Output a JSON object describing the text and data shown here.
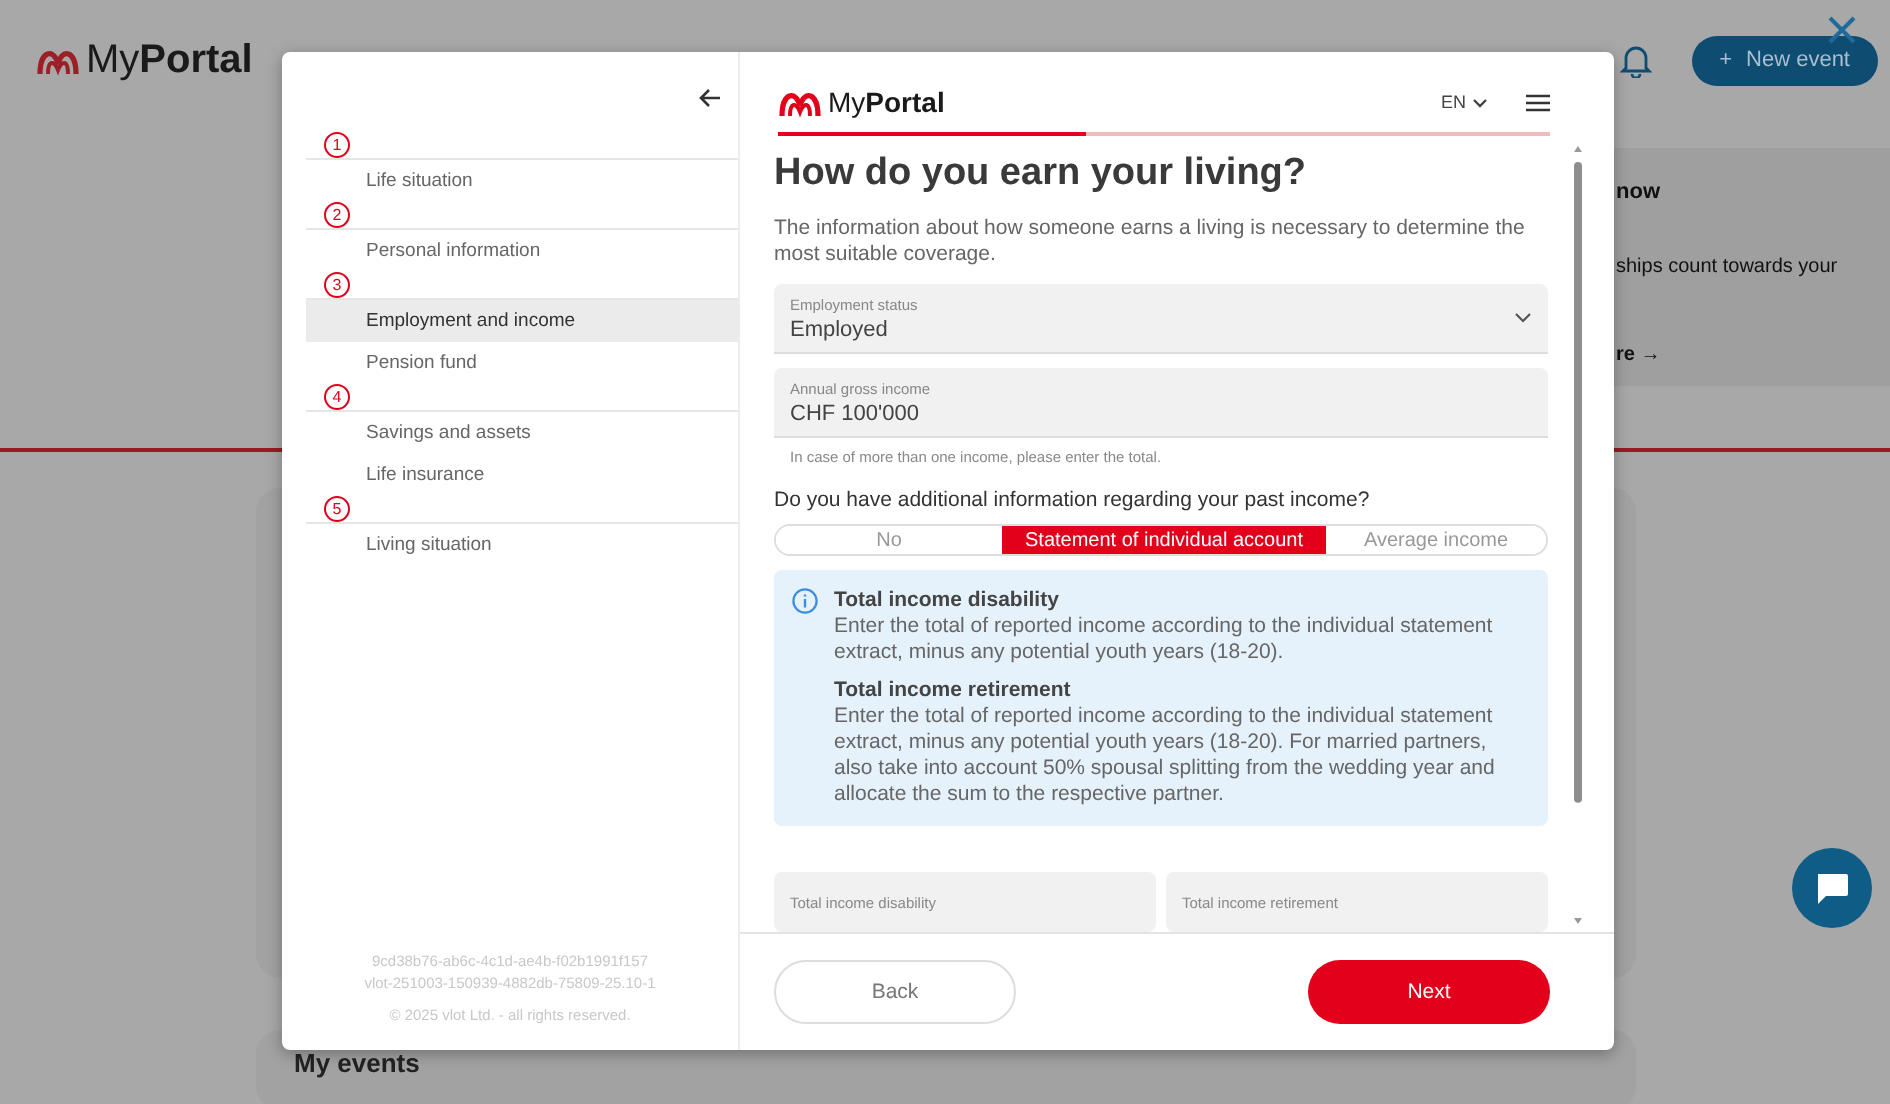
{
  "background": {
    "logo": "My**Portal**",
    "new_event_button": {
      "icon": "+",
      "label": "New event"
    },
    "info_card": {
      "title": "now",
      "text": "ships count towards your",
      "link": "re →"
    },
    "section_title": "My events"
  },
  "modal": {
    "sidebar": {
      "steps": [
        {
          "number": "1",
          "label": "Life situation",
          "selected": false
        },
        {
          "number": "2",
          "label": "Personal information",
          "selected": false
        },
        {
          "number": "3",
          "label": "Employment and income",
          "selected": true,
          "children": [
            {
              "label": "Pension fund",
              "selected": false
            }
          ]
        },
        {
          "number": "4",
          "label": "Savings and assets",
          "selected": false,
          "children": [
            {
              "label": "Life insurance",
              "selected": false
            }
          ]
        },
        {
          "number": "5",
          "label": "Living situation",
          "selected": false
        }
      ],
      "build_id": "9cd38b76-ab6c-4c1d-ae4b-f02b1991f157",
      "version": "vlot-251003-150939-4882db-75809-25.10-1",
      "copyright": "© 2025 vlot Ltd. - all rights reserved."
    },
    "header": {
      "logo": "My**Portal**",
      "language": "EN",
      "progress": {
        "level": 0.4
      }
    },
    "title": "How do you earn your living?",
    "description": "The information about how someone earns a living is necessary to determine the most suitable coverage.",
    "fields": [
      {
        "kind": "select",
        "label": "Employment status",
        "value": "Employed"
      },
      {
        "kind": "text",
        "label": "Annual gross income",
        "value": "CHF 100'000",
        "hint": "In case of more than one income, please enter the total."
      }
    ],
    "question": "Do you have additional information regarding your past income?",
    "options": [
      {
        "label": "No",
        "selected": false
      },
      {
        "label": "Statement of individual account",
        "selected": true
      },
      {
        "label": "Average income",
        "selected": false
      }
    ],
    "info": [
      {
        "title": "Total income disability",
        "text": "Enter the total of reported income according to the individual statement extract, minus any potential youth years (18-20)."
      },
      {
        "title": "Total income retirement",
        "text": "Enter the total of reported income according to the individual statement extract, minus any potential youth years (18-20). For married partners, also take into account 50% spousal splitting from the wedding year and allocate the sum to the respective partner."
      }
    ],
    "partial_fields": [
      {
        "label": "Total income disability"
      },
      {
        "label": "Total income retirement"
      }
    ],
    "buttons": {
      "back": "Back",
      "next": "Next"
    }
  }
}
